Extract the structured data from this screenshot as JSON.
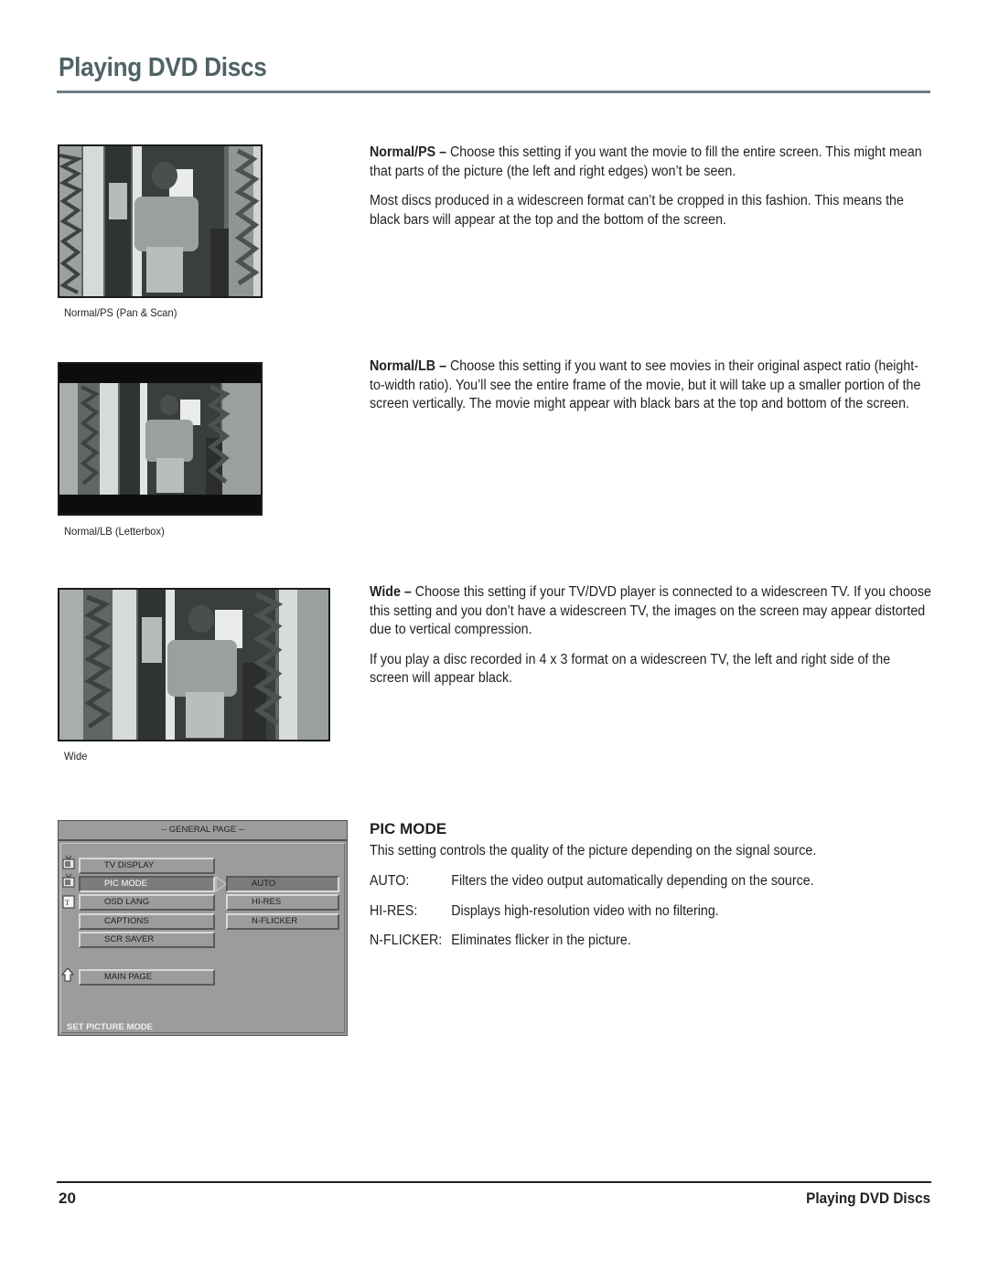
{
  "header": {
    "title": "Playing DVD Discs"
  },
  "figures": [
    {
      "id": "normal-ps",
      "caption": "Normal/PS (Pan & Scan)",
      "letterbox": false
    },
    {
      "id": "normal-lb",
      "caption": "Normal/LB (Letterbox)",
      "letterbox": true
    },
    {
      "id": "wide",
      "caption": "Wide",
      "letterbox": false
    }
  ],
  "sections": {
    "normal_ps": {
      "term": "Normal/PS –",
      "text": " Choose this setting if you want the movie to fill the entire screen. This might mean that parts of the picture (the left and right edges) won’t be seen.",
      "para2": "Most discs produced in a widescreen format can’t be cropped in this fashion. This means the black bars will appear at the top and the bottom of the screen."
    },
    "normal_lb": {
      "term": "Normal/LB –",
      "text": " Choose this setting if you want to see movies in their original aspect ratio (height-to-width ratio). You’ll see the entire frame of the movie, but it will take up a smaller portion of the screen vertically. The movie might appear with black bars at the top and bottom of the screen."
    },
    "wide": {
      "term": "Wide –",
      "text": " Choose this setting if your TV/DVD player is connected to a widescreen TV. If you choose this setting and you don’t have a widescreen TV, the images on the screen may appear distorted due to vertical compression.",
      "para2": "If you play a disc recorded in 4 x 3 format on a widescreen TV, the left and right side of the screen will appear black."
    }
  },
  "osd": {
    "header": "-- GENERAL PAGE --",
    "menu_items": [
      "TV DISPLAY",
      "PIC MODE",
      "OSD LANG",
      "CAPTIONS",
      "SCR SAVER"
    ],
    "selected_item": "PIC MODE",
    "submenu_items": [
      "AUTO",
      "HI-RES",
      "N-FLICKER"
    ],
    "selected_subitem": "AUTO",
    "main_page": "MAIN PAGE",
    "footer": "SET PICTURE MODE",
    "icons": [
      "tv-icon",
      "tv-icon",
      "text-icon",
      "up-arrow-icon"
    ]
  },
  "pic_mode": {
    "heading": "PIC MODE",
    "intro": "This setting controls the quality of the picture depending on the signal source.",
    "definitions": [
      {
        "term": "AUTO:",
        "desc": "Filters the video output automatically depending on the source."
      },
      {
        "term": "HI-RES:",
        "desc": "Displays high-resolution video with no filtering."
      },
      {
        "term": "N-FLICKER:",
        "desc": "Eliminates flicker in the picture."
      }
    ]
  },
  "footer": {
    "page_number": "20",
    "title": "Playing DVD Discs"
  }
}
